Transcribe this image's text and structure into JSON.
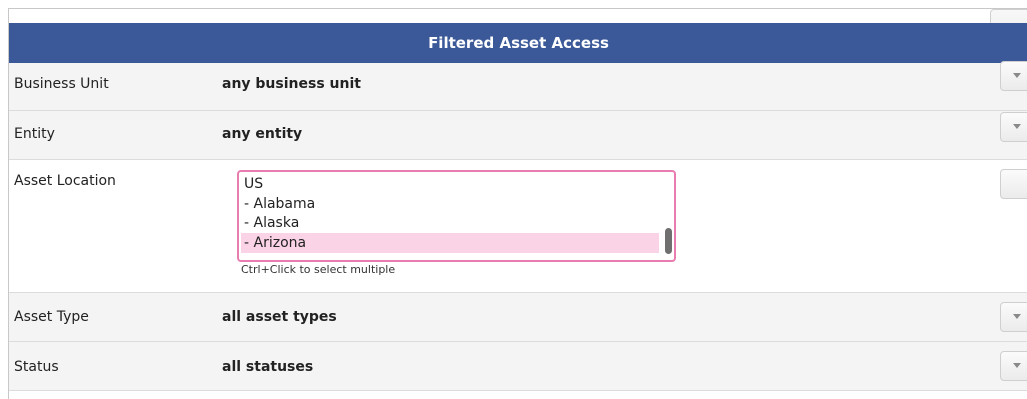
{
  "header": {
    "title": "Filtered Asset Access"
  },
  "rows": {
    "business_unit": {
      "label": "Business Unit",
      "value": "any business unit"
    },
    "entity": {
      "label": "Entity",
      "value": "any entity"
    },
    "asset_location": {
      "label": "Asset Location",
      "options": [
        "US",
        "- Alabama",
        "- Alaska",
        "- Arizona"
      ],
      "selected": "- Arizona",
      "hint": "Ctrl+Click to select multiple"
    },
    "asset_type": {
      "label": "Asset Type",
      "value": "all asset types"
    },
    "status": {
      "label": "Status",
      "value": "all statuses"
    }
  },
  "icons": {
    "dropdown": "chevron-down-icon"
  },
  "colors": {
    "header_bg": "#3b5998",
    "listbox_border": "#e87db0",
    "selected_option_bg": "#fbd3e6"
  }
}
